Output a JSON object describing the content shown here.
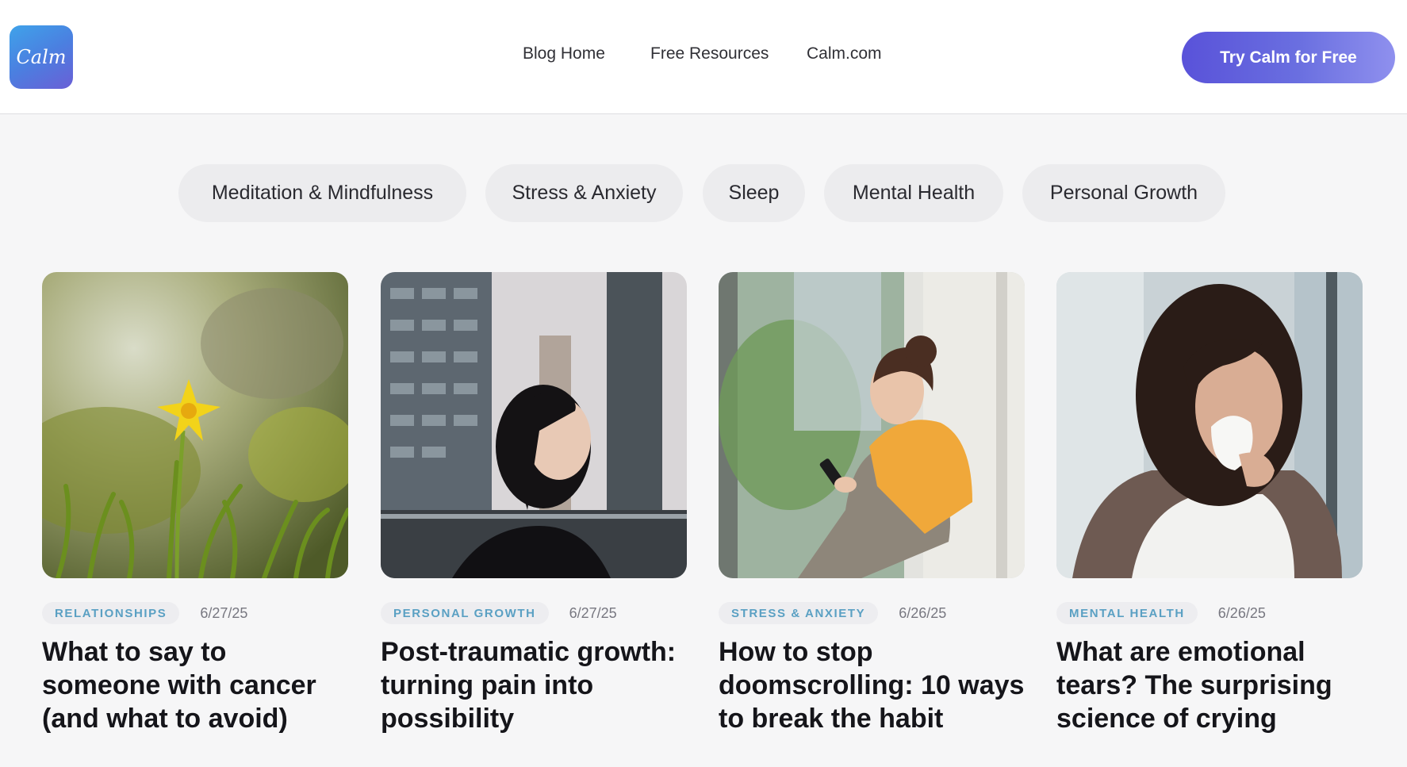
{
  "header": {
    "logo_text": "Calm",
    "nav": [
      {
        "label": "Blog Home"
      },
      {
        "label": "Free Resources"
      },
      {
        "label": "Calm.com"
      }
    ],
    "cta_label": "Try Calm for Free"
  },
  "categories": [
    {
      "label": "Meditation & Mindfulness"
    },
    {
      "label": "Stress & Anxiety"
    },
    {
      "label": "Sleep"
    },
    {
      "label": "Mental Health"
    },
    {
      "label": "Personal Growth"
    }
  ],
  "articles": [
    {
      "tag": "RELATIONSHIPS",
      "date": "6/27/25",
      "title": "What to say to someone with cancer (and what to avoid)",
      "image": "yellow-daffodil-photo"
    },
    {
      "tag": "PERSONAL GROWTH",
      "date": "6/27/25",
      "title": "Post-traumatic growth: turning pain into possibility",
      "image": "woman-looking-up-city-photo"
    },
    {
      "tag": "STRESS & ANXIETY",
      "date": "6/26/25",
      "title": "How to stop doomscrolling: 10 ways to break the habit",
      "image": "woman-on-phone-window-photo"
    },
    {
      "tag": "MENTAL HEALTH",
      "date": "6/26/25",
      "title": "What are emotional tears? The surprising science of crying",
      "image": "woman-crying-tissue-photo"
    }
  ],
  "colors": {
    "accent": "#5952d9",
    "tag_text": "#5aa0c3",
    "pill_bg": "#ececee"
  }
}
